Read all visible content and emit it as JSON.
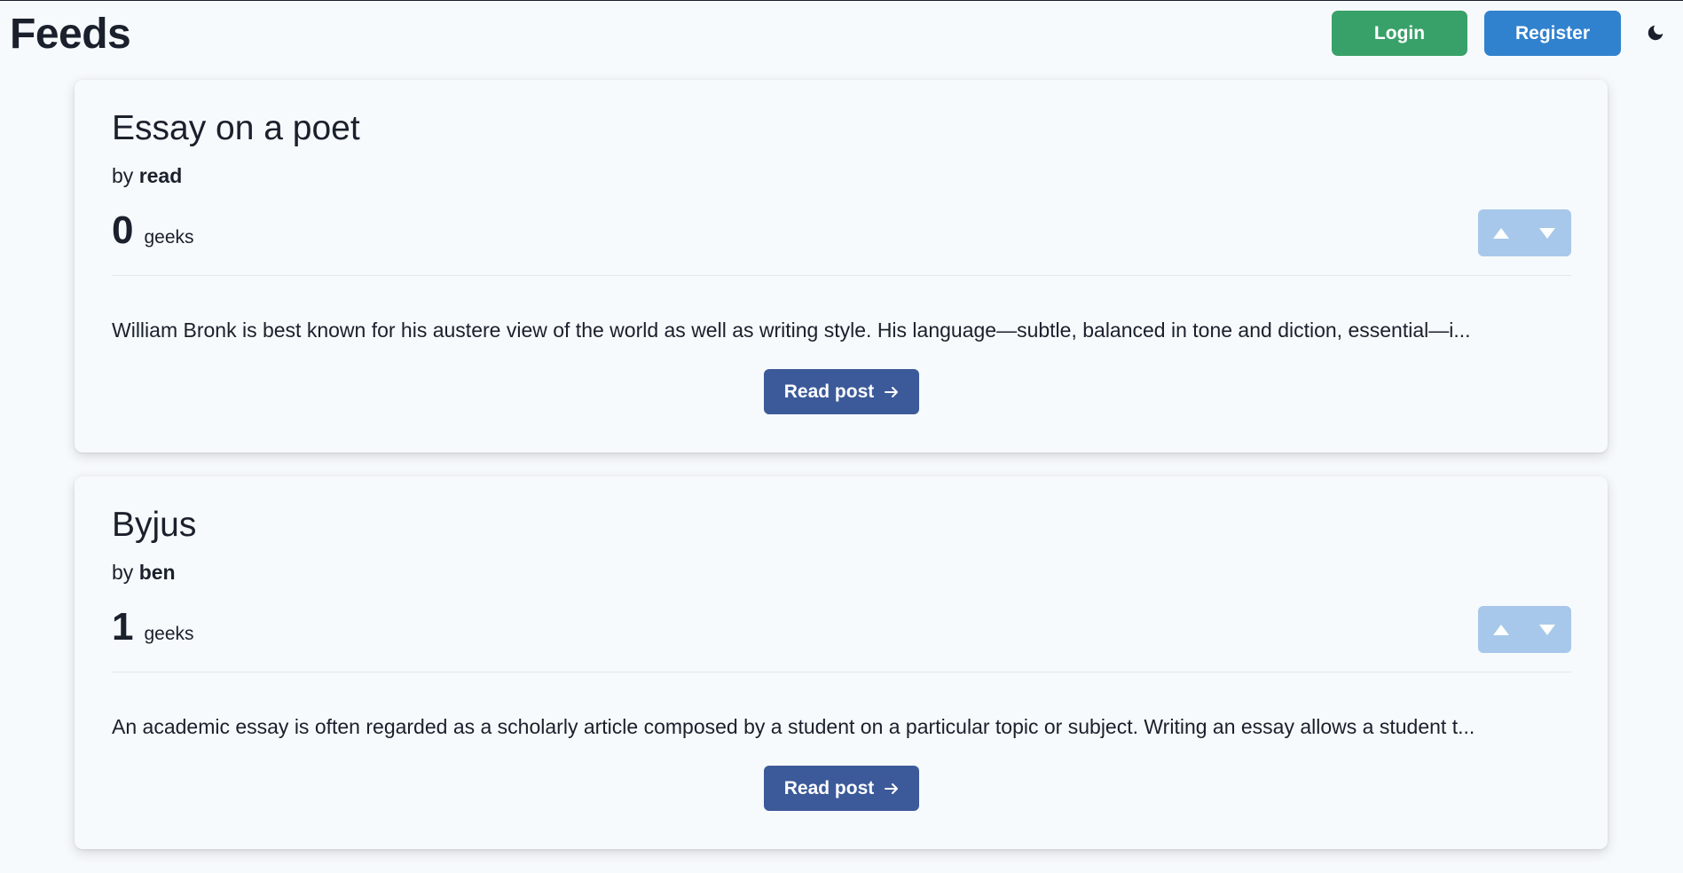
{
  "header": {
    "title": "Feeds",
    "login_label": "Login",
    "register_label": "Register",
    "theme_icon": "moon-icon"
  },
  "posts": [
    {
      "title": "Essay on a poet",
      "by_label": "by",
      "author": "read",
      "score": "0",
      "score_unit": "geeks",
      "excerpt": "William Bronk is best known for his austere view of the world as well as writing style. His language—subtle, balanced in tone and diction, essential—i...",
      "read_label": "Read post"
    },
    {
      "title": "Byjus",
      "by_label": "by",
      "author": "ben",
      "score": "1",
      "score_unit": "geeks",
      "excerpt": "An academic essay is often regarded as a scholarly article composed by a student on a particular topic or subject. Writing an essay allows a student t...",
      "read_label": "Read post"
    }
  ],
  "colors": {
    "login": "#38a169",
    "register": "#3182ce",
    "read_button": "#3c5a99",
    "vote_group": "#a7c8ea"
  }
}
